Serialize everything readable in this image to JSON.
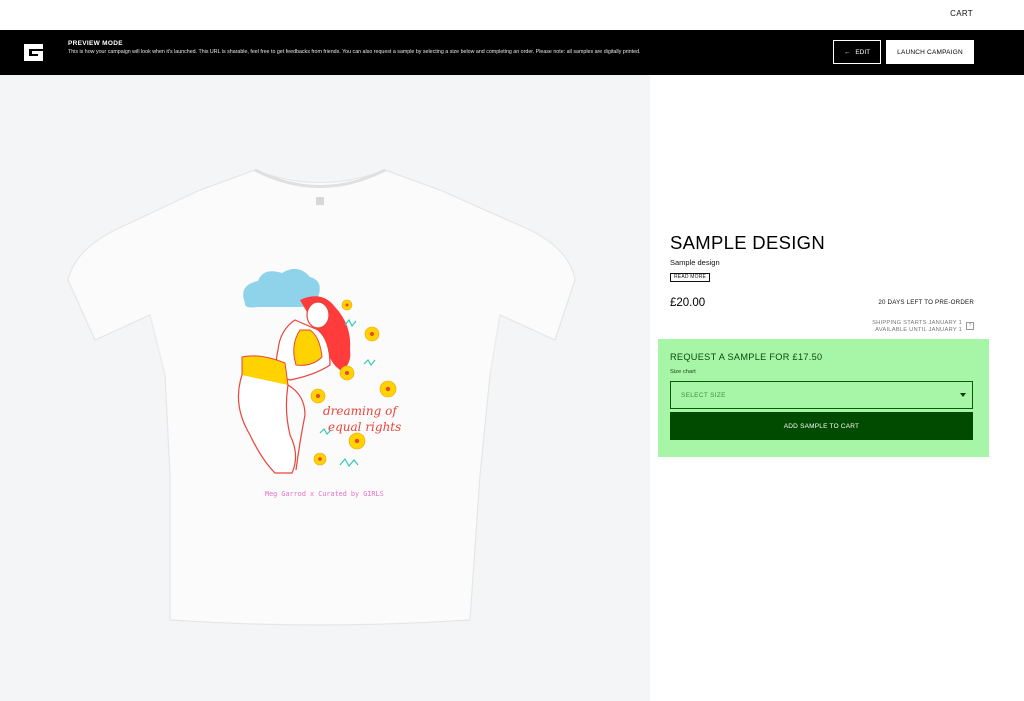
{
  "header": {
    "cart_label": "CART"
  },
  "preview": {
    "logo_icon": "brand-logo-icon",
    "title": "PREVIEW MODE",
    "text": "This is how your campaign will look when it's launched. This URL is sharable, feel free to get feedbacks from friends. You can also request a sample by selecting a size below and completing an order. Please note: all samples are digitally printed.",
    "edit_label": "EDIT",
    "edit_icon": "arrow-left-icon",
    "launch_label": "LAUNCH CAMPAIGN"
  },
  "product": {
    "title": "SAMPLE DESIGN",
    "subtitle": "Sample design",
    "read_more": "READ MORE",
    "price": "£20.00",
    "days_left": "20 DAYS LEFT TO PRE-ORDER",
    "shipping_line1": "SHIPPING STARTS JANUARY 1",
    "shipping_line2": "AVAILABLE UNTIL JANUARY 1",
    "info_icon": "info-icon",
    "image": {
      "phrase_line1": "dreaming of",
      "phrase_line2": "equal rights",
      "credit": "Meg Garrod x Curated by GIRLS"
    }
  },
  "sample": {
    "title": "REQUEST A SAMPLE FOR £17.50",
    "size_chart": "Size chart",
    "select_placeholder": "SELECT SIZE",
    "add_button": "ADD SAMPLE TO CART",
    "highlight_color": "#a7f6a7",
    "button_color": "#004b00"
  }
}
